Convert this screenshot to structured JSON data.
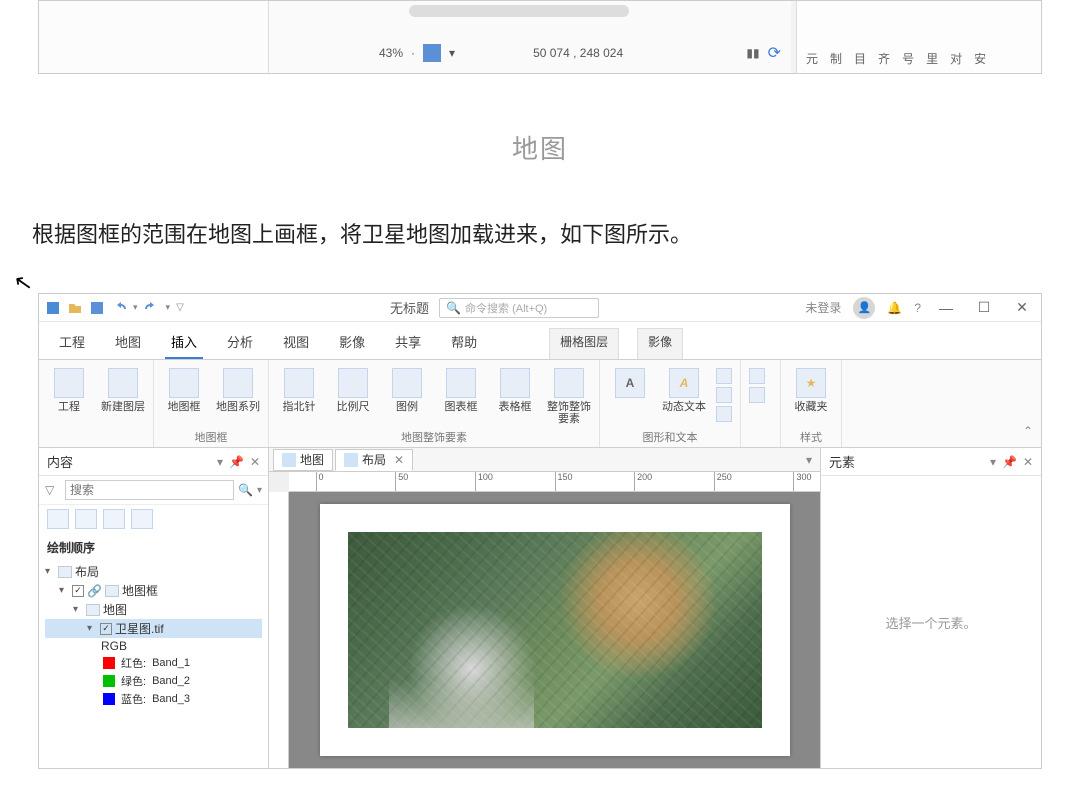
{
  "frag": {
    "percent": "43%",
    "dropdown_arrow": "▾",
    "coords": "50 074 , 248 024",
    "right_items": [
      "元",
      "制",
      "目",
      "齐",
      "号",
      "里",
      "对",
      "安"
    ]
  },
  "caption": "地图",
  "paragraph": "根据图框的范围在地图上画框，将卫星地图加载进来，如下图所示。",
  "titlebar": {
    "doc_title": "无标题",
    "search_placeholder": "命令搜索 (Alt+Q)",
    "status": "未登录"
  },
  "tabs": {
    "items": [
      "工程",
      "地图",
      "插入",
      "分析",
      "视图",
      "影像",
      "共享",
      "帮助"
    ],
    "context": [
      "栅格图层",
      "影像"
    ],
    "active_index": 2
  },
  "ribbon": {
    "groups": [
      {
        "label": "",
        "buttons": [
          {
            "label": "工程"
          },
          {
            "label": "新建图层"
          }
        ]
      },
      {
        "label": "地图框",
        "buttons": [
          {
            "label": "地图框"
          },
          {
            "label": "地图系列"
          }
        ]
      },
      {
        "label": "地图整饰要素",
        "buttons": [
          {
            "label": "指北针"
          },
          {
            "label": "比例尺"
          },
          {
            "label": "图例"
          },
          {
            "label": "图表框"
          },
          {
            "label": "表格框"
          },
          {
            "label": "整饰整饰要素"
          }
        ]
      },
      {
        "label": "图形和文本",
        "buttons": [
          {
            "label": ""
          },
          {
            "label": "动态文本"
          }
        ],
        "side": [
          "",
          "",
          ""
        ]
      },
      {
        "label": "",
        "side": [
          "",
          ""
        ]
      },
      {
        "label": "样式",
        "buttons": [
          {
            "label": "收藏夹"
          }
        ]
      }
    ]
  },
  "contents": {
    "panel_title": "内容",
    "search_placeholder": "搜索",
    "toc_title": "绘制顺序",
    "layout_name": "布局",
    "mapframe_name": "地图框",
    "map_name": "地图",
    "layer_name": "卫星图.tif",
    "rgb_label": "RGB",
    "bands": [
      {
        "color": "#ff0000",
        "label": "红色:",
        "value": "Band_1"
      },
      {
        "color": "#00c000",
        "label": "绿色:",
        "value": "Band_2"
      },
      {
        "color": "#0000ff",
        "label": "蓝色:",
        "value": "Band_3"
      }
    ]
  },
  "doctabs": {
    "map": "地图",
    "layout": "布局"
  },
  "ruler_ticks": [
    "0",
    "50",
    "100",
    "150",
    "200",
    "250",
    "300"
  ],
  "elements": {
    "panel_title": "元素",
    "placeholder": "选择一个元素。"
  }
}
